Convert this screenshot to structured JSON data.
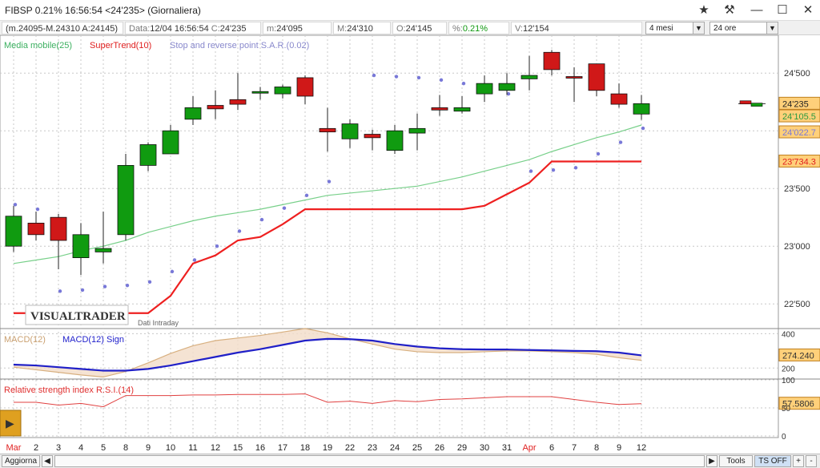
{
  "titlebar": {
    "title": "FIBSP 0.21% 16:56:54  <24'235>  (Giornaliera)"
  },
  "infobar": {
    "range": "(m.24095-M.24310 A:24145)",
    "data_label": "Data:",
    "data_value": "12/04 16:56:54",
    "c_label": "C:",
    "c_value": "24'235",
    "m_label": "m:",
    "m_value": "24'095",
    "M_label": "M:",
    "M_value": "24'310",
    "o_label": "O:",
    "o_value": "24'145",
    "pct_label": "%:",
    "pct_value": "0.21%",
    "v_label": "V:",
    "v_value": "12'154",
    "period_select": "4 mesi",
    "interval_select": "24 ore"
  },
  "legend": {
    "ma": "Media mobile(25)",
    "st": "SuperTrend(10)",
    "sar": "Stop and reverse point S.A.R.(0.02)",
    "macd": "MACD(12)",
    "macd_sign": "MACD(12) Sign",
    "rsi": "Relative strength index R.S.I.(14)"
  },
  "watermark": "VISUALTRADER",
  "watermark_sub": "Dati Intraday",
  "price_axis": [
    "24'500",
    "24'000",
    "23'500",
    "23'000",
    "22'500"
  ],
  "price_tags": {
    "close": "24'235",
    "ma": "24'105.5",
    "sar": "24'022.7",
    "supertrend": "23'734.3"
  },
  "macd_axis": [
    "400",
    "200"
  ],
  "macd_tag": "274.240",
  "rsi_axis": [
    "100",
    "50",
    "0"
  ],
  "rsi_tag": "57.5806",
  "x_labels": [
    "Mar",
    "2",
    "3",
    "4",
    "5",
    "8",
    "9",
    "10",
    "11",
    "12",
    "15",
    "16",
    "17",
    "18",
    "19",
    "22",
    "23",
    "24",
    "25",
    "26",
    "29",
    "30",
    "31",
    "Apr",
    "6",
    "7",
    "8",
    "9",
    "12"
  ],
  "statusbar": {
    "aggiorna": "Aggiorna",
    "tools": "Tools",
    "ts_off": "TS OFF",
    "plus": "+",
    "minus": "-"
  },
  "colors": {
    "up": "#109b10",
    "down": "#d01818",
    "ma": "#78d08a",
    "supertrend": "#ee2020",
    "sar": "#7878d8",
    "macd_sign": "#2020c8",
    "macd": "#d8b080",
    "rsi": "#e04040",
    "tag_bg": "#ffd07a"
  },
  "chart_data": {
    "type": "candlestick",
    "unit_y": "price",
    "ylim": [
      22300,
      24800
    ],
    "candles": [
      {
        "x": "Mar",
        "o": 23000,
        "h": 23350,
        "l": 22950,
        "c": 23260
      },
      {
        "x": "2",
        "o": 23200,
        "h": 23300,
        "l": 23050,
        "c": 23100
      },
      {
        "x": "3",
        "o": 23250,
        "h": 23280,
        "l": 22800,
        "c": 23050
      },
      {
        "x": "4",
        "o": 22900,
        "h": 23200,
        "l": 22750,
        "c": 23100
      },
      {
        "x": "5",
        "o": 22950,
        "h": 23300,
        "l": 22850,
        "c": 22980
      },
      {
        "x": "8",
        "o": 23100,
        "h": 23800,
        "l": 23050,
        "c": 23700
      },
      {
        "x": "9",
        "o": 23700,
        "h": 23900,
        "l": 23650,
        "c": 23880
      },
      {
        "x": "10",
        "o": 23800,
        "h": 24050,
        "l": 23800,
        "c": 24000
      },
      {
        "x": "11",
        "o": 24100,
        "h": 24300,
        "l": 24050,
        "c": 24200
      },
      {
        "x": "12",
        "o": 24220,
        "h": 24350,
        "l": 24100,
        "c": 24190
      },
      {
        "x": "15",
        "o": 24270,
        "h": 24500,
        "l": 24180,
        "c": 24230
      },
      {
        "x": "16",
        "o": 24330,
        "h": 24380,
        "l": 24270,
        "c": 24340
      },
      {
        "x": "17",
        "o": 24320,
        "h": 24400,
        "l": 24280,
        "c": 24380
      },
      {
        "x": "18",
        "o": 24460,
        "h": 24480,
        "l": 24230,
        "c": 24300
      },
      {
        "x": "19",
        "o": 24020,
        "h": 24200,
        "l": 23820,
        "c": 23990
      },
      {
        "x": "22",
        "o": 23930,
        "h": 24100,
        "l": 23850,
        "c": 24060
      },
      {
        "x": "23",
        "o": 23970,
        "h": 24010,
        "l": 23830,
        "c": 23940
      },
      {
        "x": "24",
        "o": 23830,
        "h": 24050,
        "l": 23800,
        "c": 24000
      },
      {
        "x": "25",
        "o": 23980,
        "h": 24150,
        "l": 23830,
        "c": 24020
      },
      {
        "x": "26",
        "o": 24200,
        "h": 24310,
        "l": 24130,
        "c": 24180
      },
      {
        "x": "29",
        "o": 24170,
        "h": 24300,
        "l": 24150,
        "c": 24200
      },
      {
        "x": "30",
        "o": 24320,
        "h": 24480,
        "l": 24250,
        "c": 24410
      },
      {
        "x": "31",
        "o": 24350,
        "h": 24500,
        "l": 24310,
        "c": 24410
      },
      {
        "x": "Apr",
        "o": 24450,
        "h": 24650,
        "l": 24350,
        "c": 24480
      },
      {
        "x": "6",
        "o": 24680,
        "h": 24700,
        "l": 24480,
        "c": 24530
      },
      {
        "x": "7",
        "o": 24470,
        "h": 24550,
        "l": 24250,
        "c": 24460
      },
      {
        "x": "8",
        "o": 24580,
        "h": 24580,
        "l": 24300,
        "c": 24350
      },
      {
        "x": "9",
        "o": 24320,
        "h": 24410,
        "l": 24200,
        "c": 24230
      },
      {
        "x": "12",
        "o": 24145,
        "h": 24310,
        "l": 24095,
        "c": 24235
      }
    ],
    "moving_average": [
      22850,
      22880,
      22910,
      22960,
      23000,
      23050,
      23120,
      23170,
      23220,
      23260,
      23290,
      23320,
      23360,
      23400,
      23440,
      23460,
      23480,
      23500,
      23520,
      23560,
      23600,
      23650,
      23700,
      23750,
      23820,
      23880,
      23940,
      23990,
      24050
    ],
    "supertrend": [
      22420,
      22420,
      22420,
      22420,
      22420,
      22420,
      22420,
      22570,
      22850,
      22920,
      23050,
      23080,
      23190,
      23320,
      23320,
      23320,
      23320,
      23320,
      23320,
      23320,
      23320,
      23350,
      23450,
      23550,
      23734,
      23734,
      23734,
      23734,
      23734
    ],
    "sar": [
      23360,
      23320,
      22610,
      22620,
      22650,
      22660,
      22690,
      22780,
      22880,
      23000,
      23130,
      23230,
      23330,
      23440,
      23560,
      null,
      24480,
      24470,
      24460,
      24440,
      24410,
      24370,
      24320,
      23650,
      23660,
      23680,
      23800,
      23900,
      24022
    ],
    "macd_series": [
      {
        "name": "MACD(12)",
        "values": [
          205,
          190,
          175,
          160,
          148,
          180,
          230,
          285,
          330,
          360,
          375,
          390,
          410,
          430,
          405,
          370,
          340,
          310,
          295,
          290,
          290,
          295,
          300,
          300,
          295,
          290,
          280,
          260,
          245
        ]
      },
      {
        "name": "MACD(12) Sign",
        "values": [
          220,
          215,
          205,
          195,
          185,
          185,
          195,
          215,
          240,
          265,
          290,
          310,
          335,
          360,
          370,
          368,
          360,
          340,
          325,
          315,
          310,
          308,
          308,
          305,
          303,
          300,
          298,
          290,
          274
        ]
      }
    ],
    "macd_ylim": [
      150,
      430
    ],
    "rsi": [
      60,
      60,
      55,
      58,
      52,
      72,
      72,
      72,
      73,
      73,
      74,
      74,
      74,
      75,
      60,
      62,
      58,
      63,
      61,
      65,
      66,
      68,
      70,
      70,
      70,
      65,
      60,
      56,
      57.58
    ],
    "rsi_ylim": [
      0,
      100
    ]
  }
}
